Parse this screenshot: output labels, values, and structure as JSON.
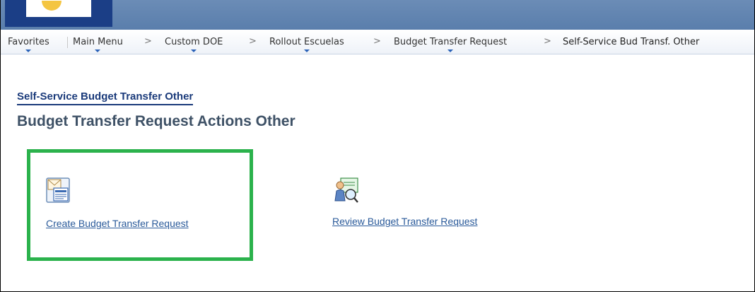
{
  "nav": {
    "favorites": "Favorites",
    "main_menu": "Main Menu",
    "custom_doe": "Custom DOE",
    "rollout": "Rollout Escuelas",
    "budget_transfer": "Budget Transfer Request",
    "self_service": "Self-Service Bud Transf. Other",
    "separator": ">"
  },
  "page": {
    "section_title": "Self-Service Budget Transfer Other",
    "title": "Budget Transfer Request Actions Other"
  },
  "actions": [
    {
      "label": "Create Budget Transfer Request",
      "icon": "mail-document-icon"
    },
    {
      "label": "Review Budget Transfer Request",
      "icon": "person-search-icon"
    }
  ],
  "colors": {
    "highlight": "#2bb24c",
    "link": "#2a5a9a",
    "header": "#5f82b0"
  }
}
